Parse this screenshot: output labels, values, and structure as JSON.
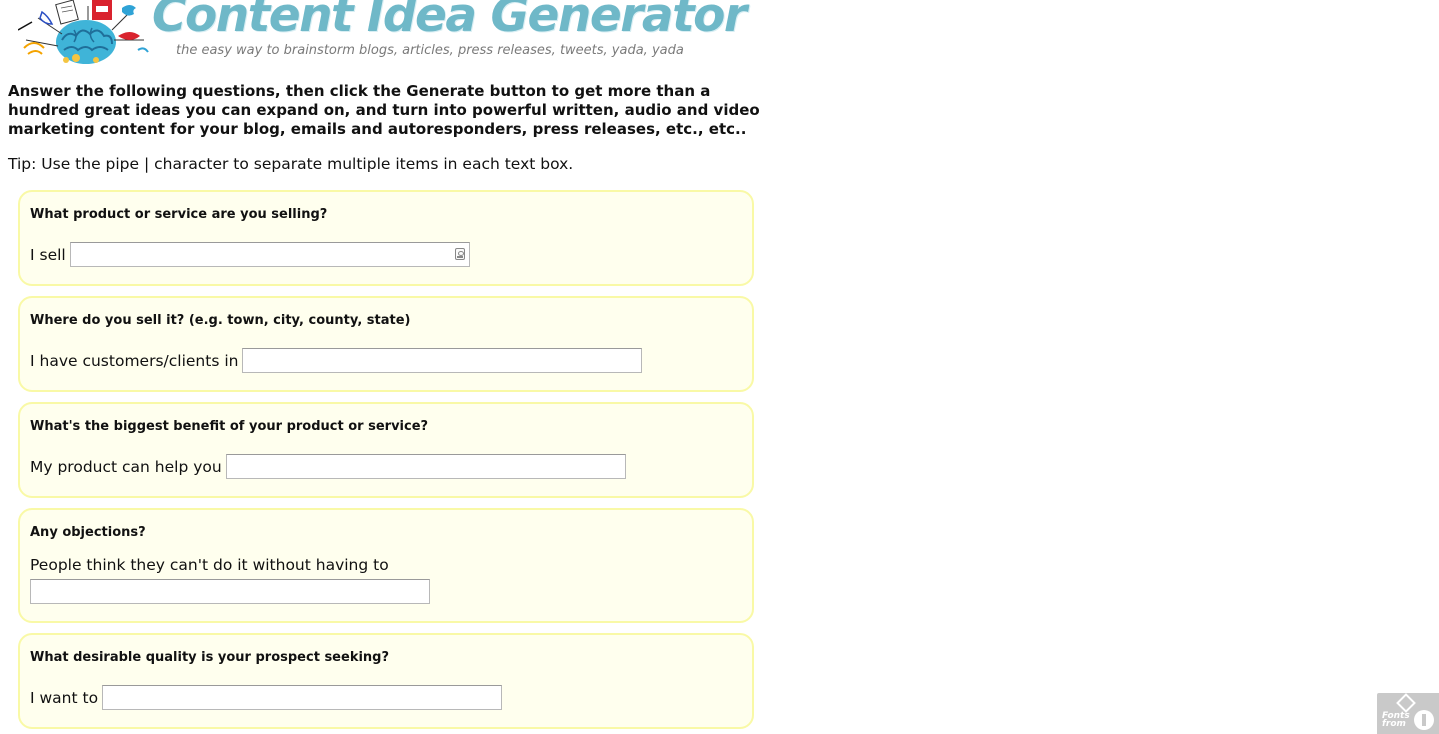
{
  "header": {
    "title": "Content Idea Generator",
    "tagline": "the easy way to brainstorm blogs, articles, press releases, tweets, yada, yada"
  },
  "intro": "Answer the following questions, then click the Generate button to get more than a hundred great ideas you can expand on, and turn into powerful written, audio and video marketing content for your blog, emails and autoresponders, press releases, etc., etc..",
  "tip": "Tip: Use the pipe | character to separate multiple items in each text box.",
  "questions": [
    {
      "question": "What product or service are you selling?",
      "label": "I sell",
      "value": ""
    },
    {
      "question": "Where do you sell it? (e.g. town, city, county, state)",
      "label": "I have customers/clients in",
      "value": ""
    },
    {
      "question": "What's the biggest benefit of your product or service?",
      "label": "My product can help you",
      "value": ""
    },
    {
      "question": "Any objections?",
      "label": "People think they can't do it without having to",
      "value": ""
    },
    {
      "question": "What desirable quality is your prospect seeking?",
      "label": "I want to",
      "value": ""
    }
  ],
  "badge": {
    "line1": "Fonts",
    "line2": "from"
  },
  "colors": {
    "title": "#6fb8c8",
    "box_background": "#ffffee",
    "box_border": "#f9f9a6"
  }
}
